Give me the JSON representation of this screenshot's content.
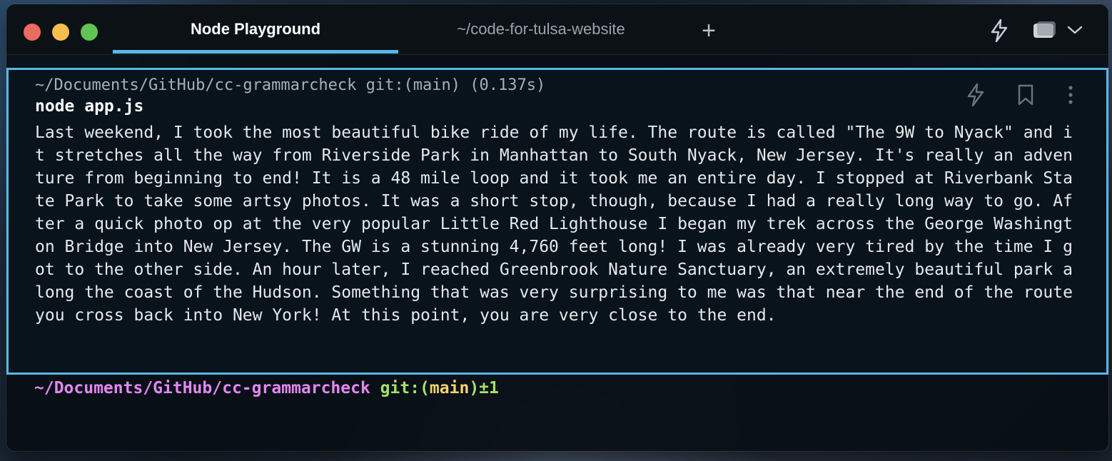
{
  "window": {
    "tabs": [
      {
        "label": "Node Playground",
        "active": true
      },
      {
        "label": "~/code-for-tulsa-website",
        "active": false
      }
    ],
    "new_tab_label": "+",
    "icons": [
      "lightning-icon",
      "split-pane-icon",
      "chevron-down-icon"
    ]
  },
  "block": {
    "prompt": "~/Documents/GitHub/cc-grammarcheck git:(main) (0.137s)",
    "command": "node app.js",
    "output": "Last weekend, I took the most beautiful bike ride of my life. The route is called \"The 9W to Nyack\" and it stretches all the way from Riverside Park in Manhattan to South Nyack, New Jersey. It's really an adventure from beginning to end! It is a 48 mile loop and it took me an entire day. I stopped at Riverbank State Park to take some artsy photos. It was a short stop, though, because I had a really long way to go. After a quick photo op at the very popular Little Red Lighthouse I began my trek across the George Washington Bridge into New Jersey. The GW is a stunning 4,760 feet long! I was already very tired by the time I got to the other side. An hour later, I reached Greenbrook Nature Sanctuary, an extremely beautiful park along the coast of the Hudson. Something that was very surprising to me was that near the end of the route you cross back into New York! At this point, you are very close to the end.",
    "actions": [
      "lightning-icon",
      "bookmark-icon",
      "more-vertical-icon"
    ]
  },
  "live_prompt": {
    "path": "~/Documents/GitHub/cc-grammarcheck",
    "git_prefix": "git:(",
    "branch": "main",
    "git_suffix": ")±1"
  },
  "colors": {
    "accent": "#59b7e6",
    "path": "#e387f0",
    "git": "#a6e06b",
    "branch": "#f2d36b"
  }
}
